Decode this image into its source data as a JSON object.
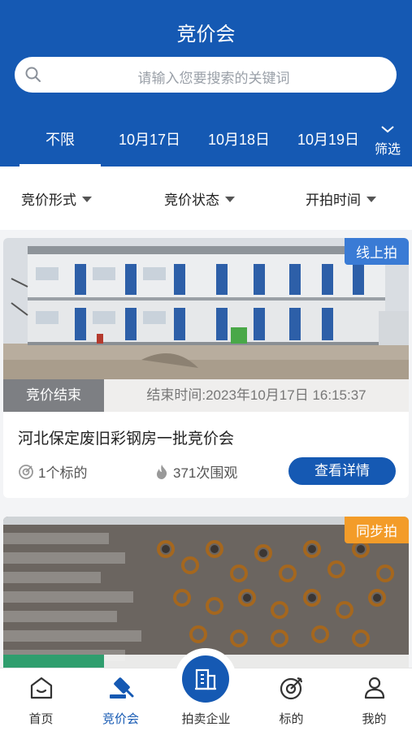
{
  "header": {
    "title": "竞价会",
    "search_placeholder": "请输入您要搜索的关键词",
    "date_tabs": [
      "不限",
      "10月17日",
      "10月18日",
      "10月19日"
    ],
    "filter_label": "筛选"
  },
  "filters": [
    "竞价形式",
    "竞价状态",
    "开拍时间"
  ],
  "auctions": [
    {
      "tag": "线上拍",
      "status": "竞价结束",
      "end_time": "结束时间:2023年10月17日 16:15:37",
      "name": "河北保定废旧彩钢房一批竞价会",
      "lots": "1个标的",
      "views": "371次围观",
      "button": "查看详情"
    },
    {
      "tag": "同步拍"
    }
  ],
  "tabbar": [
    "首页",
    "竞价会",
    "拍卖企业",
    "标的",
    "我的"
  ],
  "colors": {
    "brand": "#1559b3",
    "tag_online": "#3a7bd5",
    "tag_sync": "#f39c29"
  }
}
